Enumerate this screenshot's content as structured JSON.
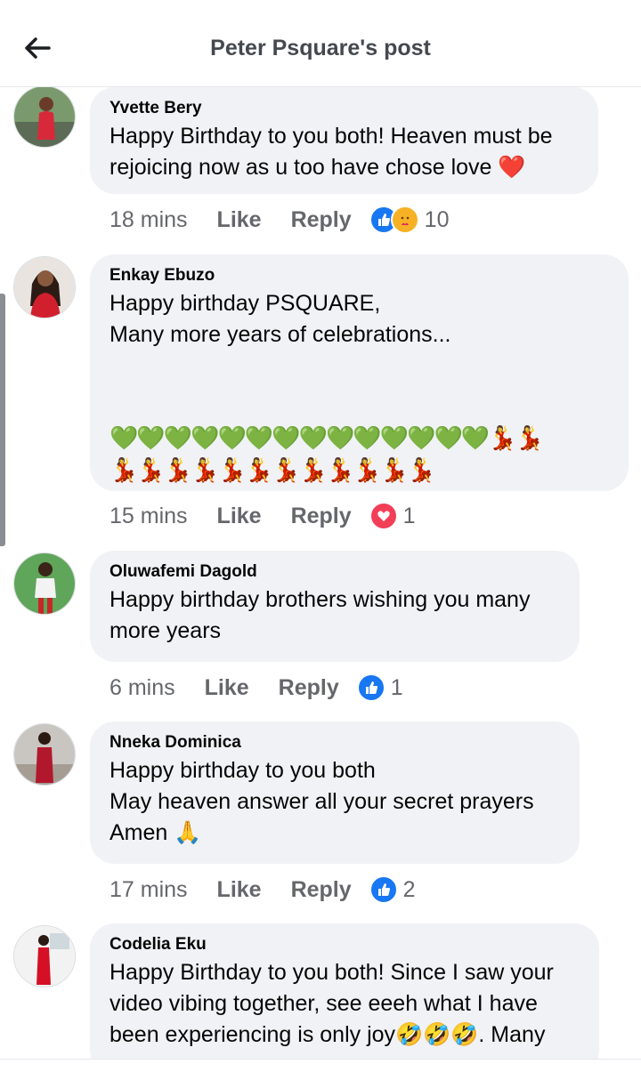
{
  "header": {
    "title": "Peter Psquare's post"
  },
  "comments": [
    {
      "author": "Yvette Bery",
      "text": "Happy Birthday to you both! Heaven must be rejoicing now as u too have chose love ❤️",
      "time": "18 mins",
      "like_label": "Like",
      "reply_label": "Reply",
      "reactions": [
        "like-icon",
        "care-icon"
      ],
      "reaction_count": "10"
    },
    {
      "author": "Enkay Ebuzo",
      "text": "Happy birthday PSQUARE,\nMany more years of celebrations...",
      "emojis": "💚💚💚💚💚💚💚💚💚💚💚💚💚💚💃💃\n💃💃💃💃💃💃💃💃💃💃💃💃",
      "time": "15 mins",
      "like_label": "Like",
      "reply_label": "Reply",
      "reactions": [
        "love-icon"
      ],
      "reaction_count": "1"
    },
    {
      "author": "Oluwafemi Dagold",
      "text": "Happy birthday brothers wishing you many more years",
      "time": "6 mins",
      "like_label": "Like",
      "reply_label": "Reply",
      "reactions": [
        "like-icon"
      ],
      "reaction_count": "1"
    },
    {
      "author": "Nneka Dominica",
      "text": "Happy birthday to you both\nMay heaven answer all your secret prayers\nAmen 🙏",
      "time": "17 mins",
      "like_label": "Like",
      "reply_label": "Reply",
      "reactions": [
        "like-icon"
      ],
      "reaction_count": "2"
    },
    {
      "author": "Codelia Eku",
      "text": "Happy Birthday to you both! Since I saw your video  vibing together, see eeeh what I have been experiencing is only joy🤣🤣🤣. Many",
      "time": "",
      "like_label": "",
      "reply_label": ""
    }
  ],
  "colors": {
    "bubble": "#f0f2f5",
    "meta_text": "#65676b",
    "like_blue": "#1877f2",
    "love_red": "#f33e58"
  }
}
